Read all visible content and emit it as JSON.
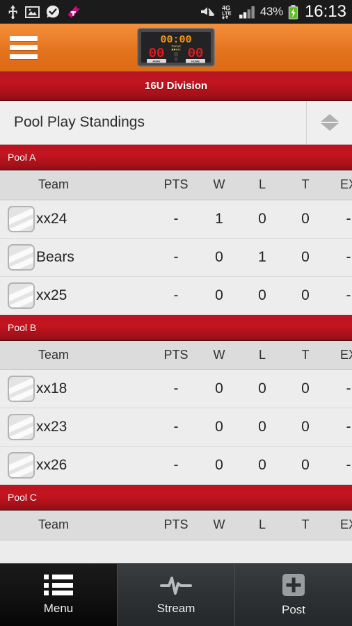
{
  "statusbar": {
    "icons_left": [
      "usb-icon",
      "image-icon",
      "check-circle-icon",
      "tmobile-icon"
    ],
    "mute_icon": "mute-icon",
    "network_label": "4G",
    "network_sub": "LTE",
    "signal_icon": "signal-bars-icon",
    "battery_percent": "43%",
    "battery_icon": "battery-charging-icon",
    "clock": "16:13"
  },
  "topbar": {
    "menu_icon": "hamburger-icon",
    "logo_name": "scoreboard-logo",
    "logo": {
      "clock": "00:00",
      "away_score": "00",
      "home_score": "00",
      "period_label": "Period",
      "away_label": "AWAY",
      "home_label": "HOME"
    }
  },
  "division": {
    "title": "16U Division"
  },
  "selector": {
    "title": "Pool Play Standings",
    "stepper_icon": "up-down-chevron-icon"
  },
  "table": {
    "columns": [
      "Team",
      "PTS",
      "W",
      "L",
      "T",
      "EX"
    ]
  },
  "pools": [
    {
      "name": "Pool A",
      "rows": [
        {
          "team": "xx24",
          "pts": "-",
          "w": "1",
          "l": "0",
          "t": "0",
          "ex": "-"
        },
        {
          "team": "Bears",
          "pts": "-",
          "w": "0",
          "l": "1",
          "t": "0",
          "ex": "-"
        },
        {
          "team": "xx25",
          "pts": "-",
          "w": "0",
          "l": "0",
          "t": "0",
          "ex": "-"
        }
      ]
    },
    {
      "name": "Pool B",
      "rows": [
        {
          "team": "xx18",
          "pts": "-",
          "w": "0",
          "l": "0",
          "t": "0",
          "ex": "-"
        },
        {
          "team": "xx23",
          "pts": "-",
          "w": "0",
          "l": "0",
          "t": "0",
          "ex": "-"
        },
        {
          "team": "xx26",
          "pts": "-",
          "w": "0",
          "l": "0",
          "t": "0",
          "ex": "-"
        }
      ]
    },
    {
      "name": "Pool C",
      "rows": []
    }
  ],
  "tabbar": {
    "tabs": [
      {
        "label": "Menu",
        "icon": "list-icon",
        "active": true
      },
      {
        "label": "Stream",
        "icon": "pulse-icon",
        "active": false
      },
      {
        "label": "Post",
        "icon": "plus-square-icon",
        "active": false
      }
    ]
  },
  "colors": {
    "orange": "#e3721d",
    "red": "#c2151f",
    "dark_red": "#8b0d15",
    "row_bg": "#ededed",
    "header_bg": "#dcdcdc"
  }
}
